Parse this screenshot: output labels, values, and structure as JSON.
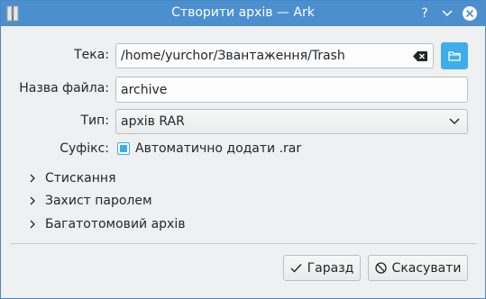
{
  "window": {
    "title": "Створити архів — Ark",
    "buttons": [
      "help-icon",
      "minimize-icon",
      "close-icon"
    ],
    "accent_color": "#4c8fce"
  },
  "form": {
    "folder": {
      "label": "Тека:",
      "value": "/home/yurchor/Звантаження/Trash"
    },
    "filename": {
      "label": "Назва файла:",
      "value": "archive"
    },
    "type": {
      "label": "Тип:",
      "value": "архів RAR"
    },
    "suffix": {
      "label": "Суфікс:",
      "checkbox_label": "Автоматично додати .rar",
      "checked": true
    }
  },
  "sections": [
    {
      "label": "Стискання",
      "expanded": false
    },
    {
      "label": "Захист паролем",
      "expanded": false
    },
    {
      "label": "Багатотомовий архів",
      "expanded": false
    }
  ],
  "buttons": {
    "ok_label": "Гаразд",
    "cancel_label": "Скасувати"
  }
}
